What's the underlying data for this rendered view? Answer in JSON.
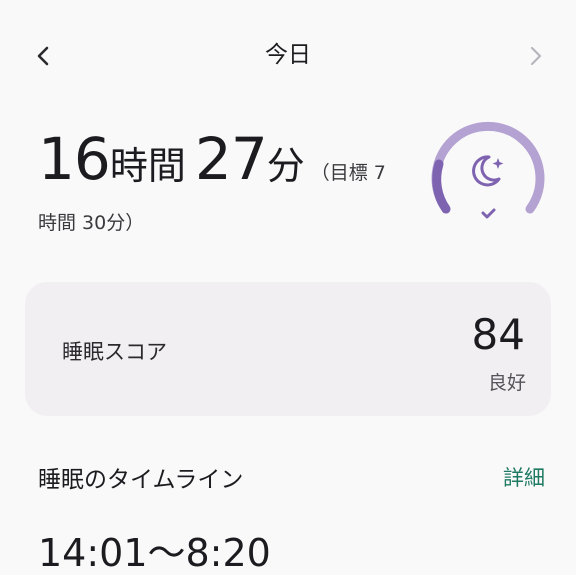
{
  "header": {
    "title": "今日",
    "prev_icon": "chevron-left-icon",
    "next_icon": "chevron-right-icon"
  },
  "summary": {
    "hours_value": "16",
    "hours_unit": "時間",
    "minutes_value": "27",
    "minutes_unit": "分",
    "goal_line1": "（目標 7",
    "goal_line2": "時間 30分）",
    "ring_icon": "moon-stars-icon",
    "ring_check_icon": "check-icon",
    "ring_color": "#9b86c2",
    "ring_track_color": "#7e63b1"
  },
  "score": {
    "label": "睡眠スコア",
    "value": "84",
    "grade": "良好"
  },
  "timeline": {
    "title": "睡眠のタイムライン",
    "detail_label": "詳細",
    "range": "14:01〜8:20",
    "accent": "#1f7a63"
  }
}
